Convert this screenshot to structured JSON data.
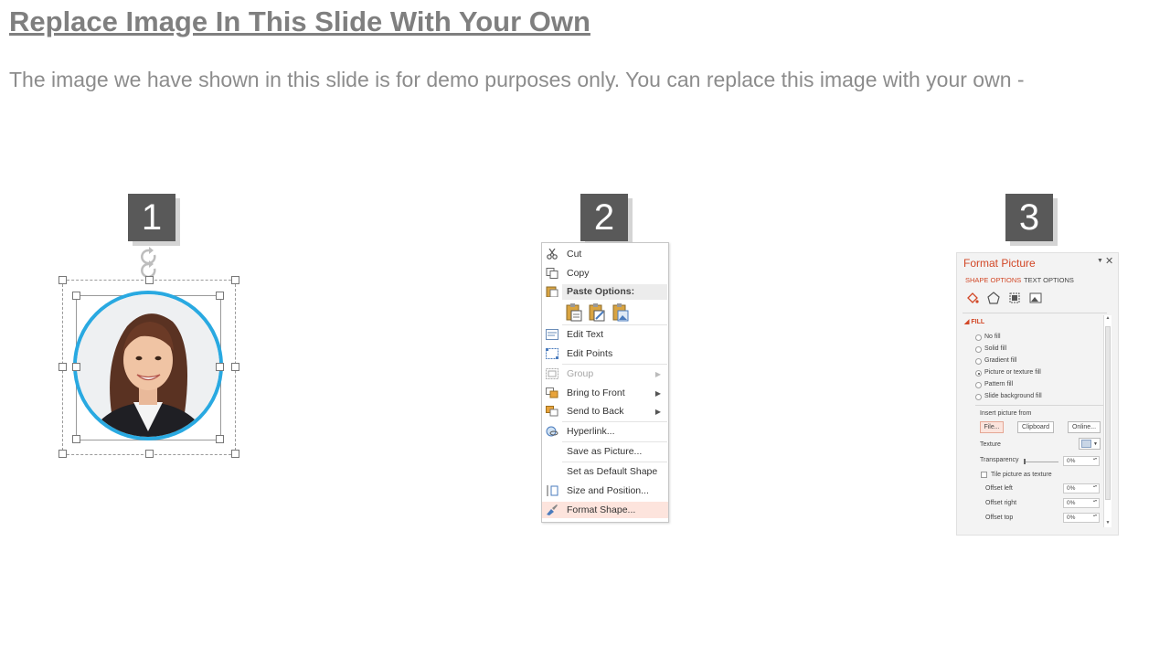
{
  "slide": {
    "title": "Replace Image In This Slide With Your Own",
    "subtitle": "The image we have shown in this slide is for demo purposes only. You can replace this image with your own -"
  },
  "steps": [
    "1",
    "2",
    "3"
  ],
  "context_menu": {
    "cut": "Cut",
    "copy": "Copy",
    "paste_options": "Paste Options:",
    "edit_text": "Edit Text",
    "edit_points": "Edit Points",
    "group": "Group",
    "bring_to_front": "Bring to Front",
    "send_to_back": "Send to Back",
    "hyperlink": "Hyperlink...",
    "save_as_picture": "Save as Picture...",
    "set_default_shape": "Set as Default Shape",
    "size_and_position": "Size and Position...",
    "format_shape": "Format Shape..."
  },
  "format_pane": {
    "title": "Format Picture",
    "tabs": [
      "SHAPE OPTIONS",
      "TEXT OPTIONS"
    ],
    "fill_section": "FILL",
    "fill_options": [
      {
        "label": "No fill",
        "selected": false
      },
      {
        "label": "Solid fill",
        "selected": false
      },
      {
        "label": "Gradient fill",
        "selected": false
      },
      {
        "label": "Picture or texture fill",
        "selected": true
      },
      {
        "label": "Pattern fill",
        "selected": false
      },
      {
        "label": "Slide background fill",
        "selected": false
      }
    ],
    "insert_from": "Insert picture from",
    "buttons": [
      "File...",
      "Clipboard",
      "Online..."
    ],
    "texture": "Texture",
    "transparency": "Transparency",
    "transparency_value": "0%",
    "tile": "Tile picture as texture",
    "offsets": [
      {
        "label": "Offset left",
        "value": "0%"
      },
      {
        "label": "Offset right",
        "value": "0%"
      },
      {
        "label": "Offset top",
        "value": "0%"
      }
    ]
  },
  "colors": {
    "accent_orange": "#d24726",
    "ring_blue": "#29a9e1",
    "badge_gray": "#595959"
  }
}
